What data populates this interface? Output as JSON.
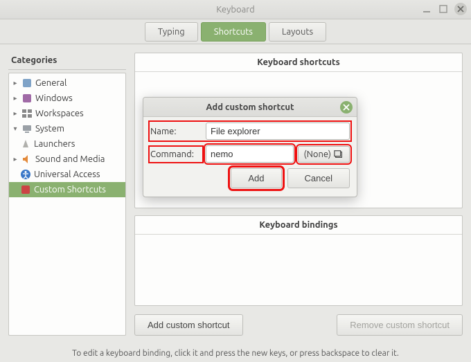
{
  "window": {
    "title": "Keyboard"
  },
  "tabs": {
    "typing": "Typing",
    "shortcuts": "Shortcuts",
    "layouts": "Layouts"
  },
  "sidebar": {
    "title": "Categories",
    "items": [
      {
        "label": "General"
      },
      {
        "label": "Windows"
      },
      {
        "label": "Workspaces"
      },
      {
        "label": "System"
      },
      {
        "label": "Launchers"
      },
      {
        "label": "Sound and Media"
      },
      {
        "label": "Universal Access"
      },
      {
        "label": "Custom Shortcuts"
      }
    ]
  },
  "panels": {
    "shortcuts_title": "Keyboard shortcuts",
    "bindings_title": "Keyboard bindings"
  },
  "actions": {
    "add_custom": "Add custom shortcut",
    "remove_custom": "Remove custom shortcut"
  },
  "footer": {
    "hint": "To edit a keyboard binding, click it and press the new keys, or press backspace to clear it."
  },
  "dialog": {
    "title": "Add custom shortcut",
    "name_label": "Name:",
    "name_value": "File explorer",
    "command_label": "Command:",
    "command_value": "nemo",
    "none_label": "(None)",
    "add": "Add",
    "cancel": "Cancel"
  }
}
